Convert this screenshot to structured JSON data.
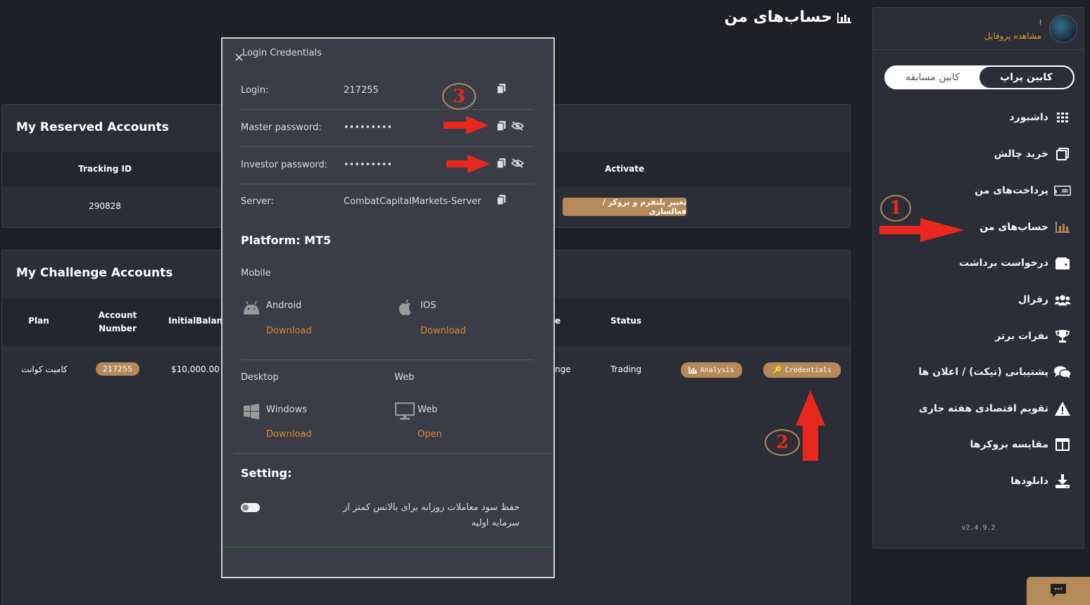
{
  "page": {
    "title": "حساب‌های من"
  },
  "profile": {
    "name": "ا",
    "link": "مشاهده پروفایل"
  },
  "cabin": {
    "active": "کابین پراپ",
    "inactive": "کابین مسابقه"
  },
  "nav": [
    {
      "label": "داشبورد",
      "icon": "grid-icon"
    },
    {
      "label": "خرید چالش",
      "icon": "copy-window-icon"
    },
    {
      "label": "پرداخت‌های من",
      "icon": "payment-card-icon"
    },
    {
      "label": "حساب‌های من",
      "icon": "bar-chart-icon"
    },
    {
      "label": "درخواست برداشت",
      "icon": "wallet-icon"
    },
    {
      "label": "رفرال",
      "icon": "users-icon"
    },
    {
      "label": "نفرات برتر",
      "icon": "trophy-icon"
    },
    {
      "label": "پشتیبانی (تیکت) / اعلان ها",
      "icon": "chat-icon"
    },
    {
      "label": "تقویم اقتصادی هفته جاری",
      "icon": "warning-icon"
    },
    {
      "label": "مقایسه بروکرها",
      "icon": "columns-icon"
    },
    {
      "label": "دانلودها",
      "icon": "download-icon"
    }
  ],
  "version": "v2.4.9.2",
  "reserved": {
    "title": "My Reserved Accounts",
    "headers": {
      "tracking": "Tracking ID",
      "activate": "Activate"
    },
    "row": {
      "tracking": "290828",
      "activate_button": "تغییر پلتفرم و بروکر / فعالسازی"
    }
  },
  "challenge": {
    "title": "My Challenge Accounts",
    "headers": {
      "plan": "Plan",
      "account_number": "Account Number",
      "initial_balance": "InitialBalanc",
      "type_fragment": "e",
      "status": "Status"
    },
    "row": {
      "plan": "کامبت کوانت",
      "account_number": "217255",
      "initial_balance": "$10,000.00",
      "type_fragment": "nge",
      "status": "Trading",
      "analysis": "Analysis",
      "credentials": "Credentials"
    }
  },
  "modal": {
    "title": "Login Credentials",
    "close": "×",
    "credentials": [
      {
        "label": "Login:",
        "value": "217255"
      },
      {
        "label": "Master password:",
        "value": "•••••••••"
      },
      {
        "label": "Investor password:",
        "value": "•••••••••"
      },
      {
        "label": "Server:",
        "value": "CombatCapitalMarkets-Server"
      }
    ],
    "platform": "Platform: MT5",
    "mobile": "Mobile",
    "android": {
      "name": "Android",
      "link": "Download"
    },
    "ios": {
      "name": "IOS",
      "link": "Download"
    },
    "desktop": "Desktop",
    "web": "Web",
    "windows": {
      "name": "Windows",
      "link": "Download"
    },
    "webapp": {
      "name": "Web",
      "link": "Open"
    },
    "setting_title": "Setting:",
    "setting_text": "حفظ سود معاملات روزانه برای بالانس کمتر از سرمایه اولیه",
    "setting_enabled": false
  },
  "annotations": {
    "one": "1",
    "two": "2",
    "three": "3"
  },
  "colors": {
    "accent": "#b38a58",
    "link": "#d98b3a",
    "bg": "#1e2026",
    "panel": "#2b2e37",
    "arrow": "#e8281e"
  }
}
